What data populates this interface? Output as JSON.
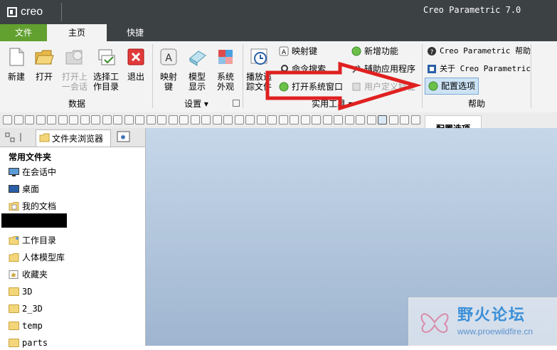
{
  "app": {
    "logo_text": "creo",
    "title": "Creo Parametric 7.0"
  },
  "tabs": [
    {
      "label": "文件"
    },
    {
      "label": "主页"
    },
    {
      "label": "快捷"
    }
  ],
  "ribbon": {
    "data_group": {
      "label": "数据",
      "buttons": [
        {
          "line1": "新建",
          "line2": ""
        },
        {
          "line1": "打开",
          "line2": ""
        },
        {
          "line1": "打开上",
          "line2": "一会话"
        },
        {
          "line1": "选择工",
          "line2": "作目录"
        },
        {
          "line1": "退出",
          "line2": ""
        }
      ]
    },
    "settings_group": {
      "label": "设置",
      "buttons": [
        {
          "line1": "映射",
          "line2": "键"
        },
        {
          "line1": "模型",
          "line2": "显示"
        },
        {
          "line1": "系统",
          "line2": "外观"
        }
      ]
    },
    "utilities_group": {
      "label": "实用工具",
      "big_button": {
        "line1": "播放追",
        "line2": "踪文件"
      },
      "items": [
        {
          "label": "映射键"
        },
        {
          "label": "新增功能"
        },
        {
          "label": "命令搜索"
        },
        {
          "label": "辅助应用程序"
        },
        {
          "label": "打开系统窗口"
        },
        {
          "label": "用户定义特征"
        }
      ]
    },
    "help_group": {
      "label": "帮助",
      "items": [
        {
          "label": "Creo Parametric 帮助"
        },
        {
          "label": "关于 Creo Parametric"
        },
        {
          "label": "配置选项"
        }
      ]
    }
  },
  "tooltip": {
    "text": "配置选项"
  },
  "left_panel": {
    "tab_label": "文件夹浏览器",
    "section_title": "常用文件夹",
    "items": [
      {
        "label": "在会话中",
        "icon": "monitor-icon"
      },
      {
        "label": "桌面",
        "icon": "desktop-icon"
      },
      {
        "label": "我的文档",
        "icon": "documents-icon"
      },
      {
        "label": "工作目录",
        "icon": "workdir-folder-icon"
      },
      {
        "label": "人体模型库",
        "icon": "manikin-folder-icon"
      },
      {
        "label": "收藏夹",
        "icon": "favorites-icon"
      },
      {
        "label": "3D",
        "icon": "folder-icon"
      },
      {
        "label": "2_3D",
        "icon": "folder-icon"
      },
      {
        "label": "temp",
        "icon": "folder-icon"
      },
      {
        "label": "parts",
        "icon": "folder-icon"
      }
    ]
  },
  "watermark": {
    "title": "野火论坛",
    "url": "www.proewildfire.cn"
  },
  "colors": {
    "titlebar": "#3c4144",
    "file_tab": "#62a030",
    "arrow": "#e02020",
    "viewport_top": "#c6d7e9",
    "viewport_bottom": "#9fb5d0"
  }
}
